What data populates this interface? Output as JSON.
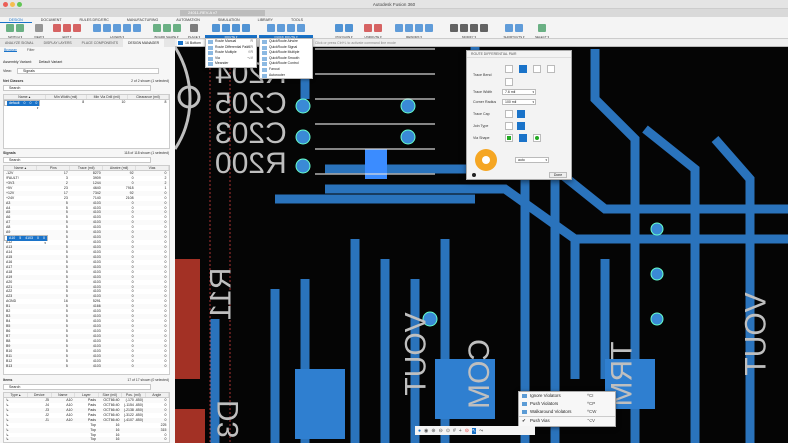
{
  "window": {
    "title": "Autodesk Fusion 360",
    "file_tab": "24011-REV-A v7"
  },
  "ribbon": {
    "tabs": [
      "DESIGN",
      "DOCUMENT",
      "RULES DRC/ERC",
      "MANUFACTURING",
      "AUTOMATION",
      "SIMULATION",
      "LIBRARY",
      "TOOLS"
    ],
    "groups": [
      "SWITCH ▾",
      "VIEW ▾",
      "EDIT ▾",
      "LAYERS ▾",
      "BOARD SHAPE ▾",
      "PLACE ▾",
      "ROUTE ▾",
      "QUICK ROUTE ▾",
      "POLYGON ▾",
      "UNROUTE ▾",
      "REWORK ▾",
      "MODIFY ▾",
      "SHORTCUTS ▾",
      "SELECT ▾"
    ]
  },
  "route_menu": [
    {
      "label": "Route Manual",
      "shortcut": "R"
    },
    {
      "label": "Route Differential Pair",
      "shortcut": "⌘R"
    },
    {
      "label": "Route Multiple",
      "shortcut": "⇧R"
    },
    {
      "label": "Via",
      "shortcut": "⌥V"
    },
    {
      "label": "Meander",
      "shortcut": ""
    }
  ],
  "quickroute_menu": [
    "QuickRoute Airwire",
    "QuickRoute Signal",
    "QuickRoute Multiple",
    "QuickRoute Smooth",
    "QuickRoute Control",
    "Fanout",
    "Autorouter"
  ],
  "left_tabs": [
    "ANALYZE SIGNAL",
    "DISPLAY LAYERS",
    "PLACE COMPONENTS",
    "DESIGN MANAGER"
  ],
  "panel": {
    "subtabs": [
      "Browser",
      "Filter"
    ],
    "assembly_label": "Assembly Variant:",
    "assembly_value": "Default Variant",
    "view_label": "View:",
    "view_value": "Signals",
    "net_classes": {
      "title": "Net Classes",
      "count": "2 of 2 shown (1 selected)",
      "search": "Search",
      "headers": [
        "Name ▴",
        "Min Width (mil)",
        "Min Via Drill (mil)",
        "Clearance (mil)"
      ],
      "rows": [
        [
          "default",
          "0",
          "0",
          "0"
        ],
        [
          "USB_PAIR",
          "8",
          "10",
          "8"
        ]
      ]
    },
    "signals": {
      "title": "Signals",
      "count": "118 of 118 shown (1 selected)",
      "search": "Search",
      "headers": [
        "Name ▴",
        "Pins",
        "Trace (mil)",
        "Airwire (mil)",
        "Vias"
      ],
      "rows": [
        [
          "-12V",
          "17",
          "8270",
          "92",
          "0"
        ],
        [
          "!FAULT!",
          "3",
          "3909",
          "0",
          "2"
        ],
        [
          "+3V3",
          "2",
          "1244",
          "0",
          "2"
        ],
        [
          "+5V",
          "23",
          "4640",
          "7918",
          "1"
        ],
        [
          "+12V",
          "17",
          "7342",
          "92",
          "0"
        ],
        [
          "+24V",
          "23",
          "7140",
          "2108",
          "0"
        ],
        [
          "A3",
          "5",
          "4103",
          "0",
          "0"
        ],
        [
          "A4",
          "5",
          "4103",
          "0",
          "0"
        ],
        [
          "A5",
          "5",
          "4103",
          "0",
          "0"
        ],
        [
          "A6",
          "5",
          "4103",
          "0",
          "0"
        ],
        [
          "A7",
          "5",
          "4103",
          "0",
          "0"
        ],
        [
          "A8",
          "5",
          "4103",
          "0",
          "0"
        ],
        [
          "A9",
          "5",
          "4103",
          "0",
          "0"
        ],
        [
          "A10",
          "5",
          "4103",
          "0",
          "0"
        ],
        [
          "A11",
          "5",
          "4103",
          "0",
          "0"
        ],
        [
          "A12",
          "5",
          "4103",
          "0",
          "0"
        ],
        [
          "A13",
          "5",
          "4103",
          "0",
          "0"
        ],
        [
          "A14",
          "5",
          "4103",
          "0",
          "0"
        ],
        [
          "A15",
          "5",
          "4103",
          "0",
          "0"
        ],
        [
          "A16",
          "5",
          "4103",
          "0",
          "0"
        ],
        [
          "A17",
          "5",
          "4103",
          "0",
          "0"
        ],
        [
          "A18",
          "5",
          "4103",
          "0",
          "0"
        ],
        [
          "A19",
          "5",
          "4103",
          "0",
          "0"
        ],
        [
          "A20",
          "5",
          "4103",
          "0",
          "0"
        ],
        [
          "A21",
          "5",
          "4103",
          "0",
          "0"
        ],
        [
          "A22",
          "5",
          "4103",
          "0",
          "0"
        ],
        [
          "A23",
          "5",
          "4103",
          "0",
          "0"
        ],
        [
          "AGND",
          "16",
          "5291",
          "0",
          "0"
        ],
        [
          "B1",
          "5",
          "4166",
          "0",
          "0"
        ],
        [
          "B2",
          "5",
          "4103",
          "0",
          "0"
        ],
        [
          "B3",
          "5",
          "4103",
          "0",
          "0"
        ],
        [
          "B4",
          "5",
          "4103",
          "0",
          "0"
        ],
        [
          "B5",
          "5",
          "4103",
          "0",
          "0"
        ],
        [
          "B6",
          "5",
          "4103",
          "0",
          "0"
        ],
        [
          "B7",
          "5",
          "4103",
          "0",
          "0"
        ],
        [
          "B8",
          "5",
          "4103",
          "0",
          "0"
        ],
        [
          "B9",
          "5",
          "4103",
          "0",
          "0"
        ],
        [
          "B10",
          "5",
          "4103",
          "0",
          "0"
        ],
        [
          "B11",
          "5",
          "4103",
          "0",
          "0"
        ],
        [
          "B12",
          "5",
          "4103",
          "0",
          "0"
        ],
        [
          "B13",
          "5",
          "4103",
          "0",
          "0"
        ]
      ],
      "selected": "A10"
    },
    "items": {
      "title": "Items",
      "count": "17 of 17 shown (0 selected)",
      "search": "Search",
      "headers": [
        "Type ▴",
        "Device",
        "Name",
        "Layer",
        "Size (mil)",
        "Pos. (mil)",
        "Angle"
      ],
      "rows": [
        [
          "↳",
          "J5",
          "A10",
          "Pads",
          "OCT66:40",
          "(-170 -650)",
          "0"
        ],
        [
          "↳",
          "J4",
          "A10",
          "Pads",
          "OCT66:40",
          "(-1154 -650)",
          "0"
        ],
        [
          "↳",
          "J3",
          "A10",
          "Pads",
          "OCT66:40",
          "(-2138 -650)",
          "0"
        ],
        [
          "↳",
          "J2",
          "A10",
          "Pads",
          "OCT66:40",
          "(-3122 -650)",
          "0"
        ],
        [
          "↳",
          "J1",
          "A10",
          "Pads",
          "OCT66:40",
          "(-4107 -650)",
          "0"
        ],
        [
          "↳",
          "",
          "",
          "Top",
          "16",
          "",
          "225"
        ],
        [
          "↳",
          "",
          "",
          "Top",
          "16",
          "",
          "315"
        ],
        [
          "↳",
          "",
          "",
          "Top",
          "16",
          "",
          "0"
        ],
        [
          "↳",
          "",
          "",
          "Top",
          "16",
          "",
          "0"
        ],
        [
          "↳",
          "",
          "",
          "Top",
          "16",
          "",
          "225"
        ]
      ]
    }
  },
  "canvas": {
    "layer": "16 Bottom",
    "command_hint": "Click or press Ctrl+L to activate command line mode",
    "silkscreen": [
      "R204",
      "C205",
      "C203",
      "R200",
      "R11",
      "VOUT",
      "D3",
      "COM",
      "TRM",
      "VOUT"
    ]
  },
  "dialog": {
    "title": "ROUTE DIFFERENTIAL PAIR",
    "trace_bend": "Trace Bend",
    "trace_width_label": "Trace Width",
    "trace_width": "7.6 mil",
    "corner_radius_label": "Corner Radius",
    "corner_radius": "100 mil",
    "trace_cap": "Trace Cap",
    "join_type": "Join Type",
    "via_shape": "Via Shape",
    "via_size": "auto",
    "done": "Done"
  },
  "context_menu": [
    {
      "label": "Ignore Violators",
      "shortcut": "^CI"
    },
    {
      "label": "Push Violators",
      "shortcut": "^CP"
    },
    {
      "label": "Walkaround Violators",
      "shortcut": "^CW"
    },
    {
      "label": "Push Vias",
      "shortcut": "⌥V",
      "checked": "✔"
    }
  ],
  "colors": {
    "accent": "#1a73c9",
    "copper_bottom": "#2f7fd0",
    "pad": "#3a8ad6",
    "silk": "#bfbfbf"
  }
}
